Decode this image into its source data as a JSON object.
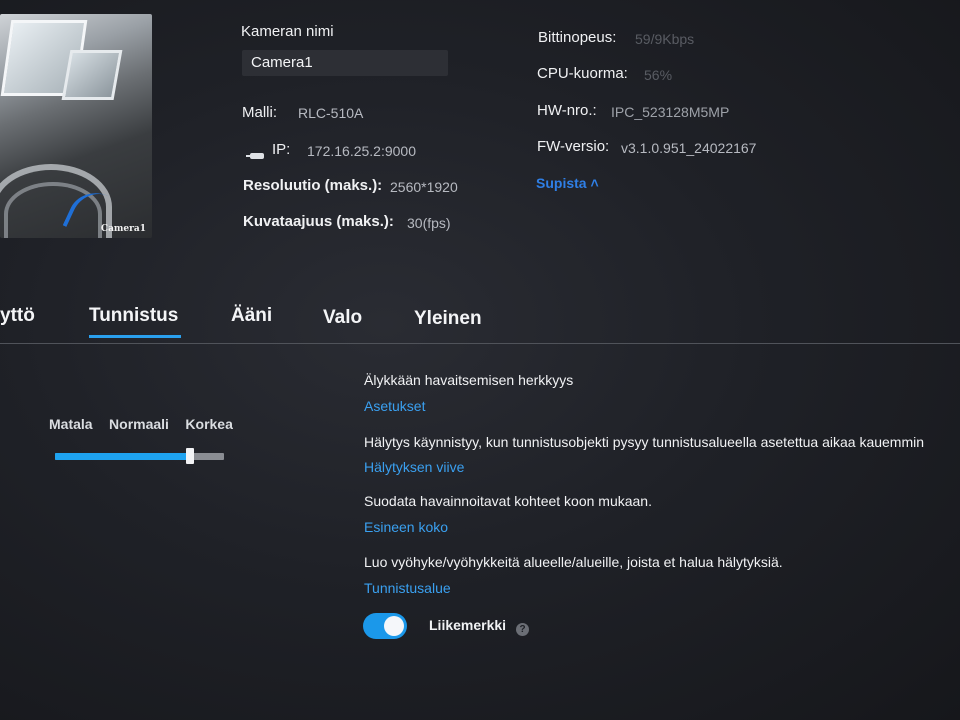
{
  "preview": {
    "caption": "Camera1"
  },
  "device": {
    "camera_name_label": "Kameran nimi",
    "camera_name_value": "Camera1",
    "model_label": "Malli:",
    "model_value": "RLC-510A",
    "ip_label": "IP:",
    "ip_value": "172.16.25.2:9000",
    "resolution_label": "Resoluutio (maks.):",
    "resolution_value": "2560*1920",
    "framerate_label": "Kuvataajuus (maks.):",
    "framerate_value": "30(fps)",
    "bitrate_label": "Bittinopeus:",
    "bitrate_value": "59/9Kbps",
    "cpu_label": "CPU-kuorma:",
    "cpu_value": "56%",
    "hw_label": "HW-nro.:",
    "hw_value": "IPC_523128M5MP",
    "fw_label": "FW-versio:",
    "fw_value": "v3.1.0.951_24022167",
    "collapse_label": "Supista ˄"
  },
  "tabs": [
    "yttö",
    "Tunnistus",
    "Ääni",
    "Valo",
    "Yleinen"
  ],
  "active_tab": "Tunnistus",
  "sensitivity": {
    "levels": [
      "Matala",
      "Normaali",
      "Korkea"
    ],
    "value_fraction": 0.8
  },
  "sections": {
    "smart_title": "Älykkään havaitsemisen herkkyys",
    "smart_link": "Asetukset",
    "delay_title": "Hälytys käynnistyy, kun tunnistusobjekti pysyy tunnistusalueella asetettua aikaa kauemmin",
    "delay_link": "Hälytyksen viive",
    "size_title": "Suodata havainnoitavat kohteet koon mukaan.",
    "size_link": "Esineen koko",
    "zone_title": "Luo vyöhyke/vyöhykkeitä alueelle/alueille, joista et halua hälytyksiä.",
    "zone_link": "Tunnistusalue",
    "motion_label": "Liikemerkki",
    "motion_enabled": true
  },
  "colors": {
    "accent": "#1ea3f0",
    "link": "#3aa0f0",
    "background": "#1f2127"
  }
}
